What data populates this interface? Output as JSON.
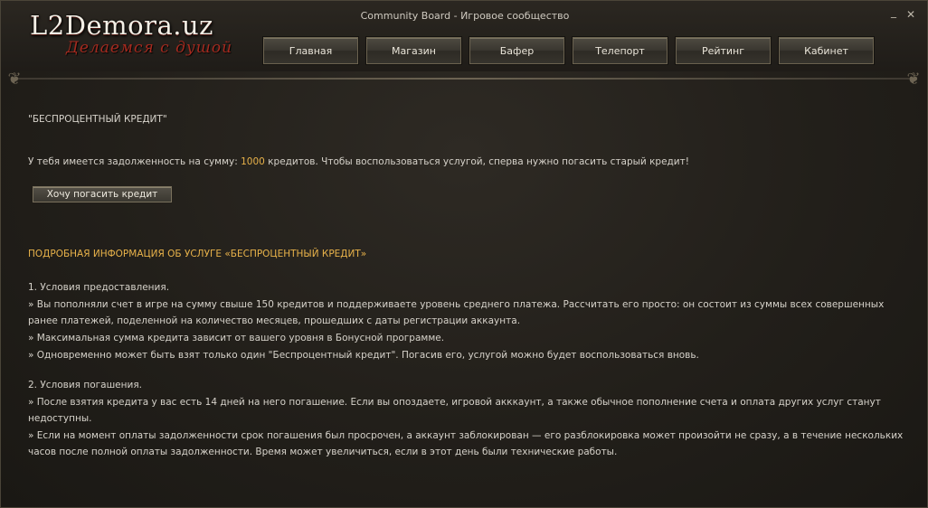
{
  "window": {
    "title": "Community Board - Игровое сообщество"
  },
  "logo": {
    "main": "L2Demora.uz",
    "sub": "Делаемся с душой"
  },
  "nav": {
    "items": [
      "Главная",
      "Магазин",
      "Бафер",
      "Телепорт",
      "Рейтинг",
      "Кабинет"
    ]
  },
  "page": {
    "heading": "\"БЕСПРОЦЕНТНЫЙ КРЕДИТ\"",
    "debt_prefix": "У тебя имеется задолженность на сумму: ",
    "debt_amount": "1000",
    "debt_suffix": " кредитов. Чтобы воспользоваться услугой, сперва нужно погасить старый кредит!",
    "repay_button": "Хочу погасить кредит",
    "info_title": "ПОДРОБНАЯ ИНФОРМАЦИЯ ОБ УСЛУГЕ «БЕСПРОЦЕНТНЫЙ КРЕДИТ»",
    "conditions": {
      "title": "1. Условия предоставления.",
      "items": [
        "» Вы пополняли счет в игре на сумму свыше 150 кредитов и поддерживаете уровень среднего платежа. Рассчитать его просто: он состоит из суммы всех совершенных ранее платежей, поделенной на количество месяцев, прошедших с даты регистрации аккаунта.",
        "» Максимальная сумма кредита зависит от вашего уровня в Бонусной программе.",
        "» Одновременно может быть взят только один \"Беспроцентный кредит\". Погасив его, услугой можно будет воспользоваться вновь."
      ]
    },
    "repayment": {
      "title": "2. Условия погашения.",
      "items": [
        "» После взятия кредита у вас есть 14 дней на него погашение. Если вы опоздаете, игровой акккаунт, а также обычное пополнение счета и оплата других услуг станут недоступны.",
        "» Если на момент оплаты задолженности срок погашения был просрочен, а аккаунт заблокирован — его разблокировка может произойти не сразу, а в течение нескольких часов после полной оплаты задолженности. Время может увеличиться, если в этот день были технические работы."
      ]
    }
  },
  "colors": {
    "accent": "#e8b24a",
    "logo_red": "#a52a1f"
  }
}
